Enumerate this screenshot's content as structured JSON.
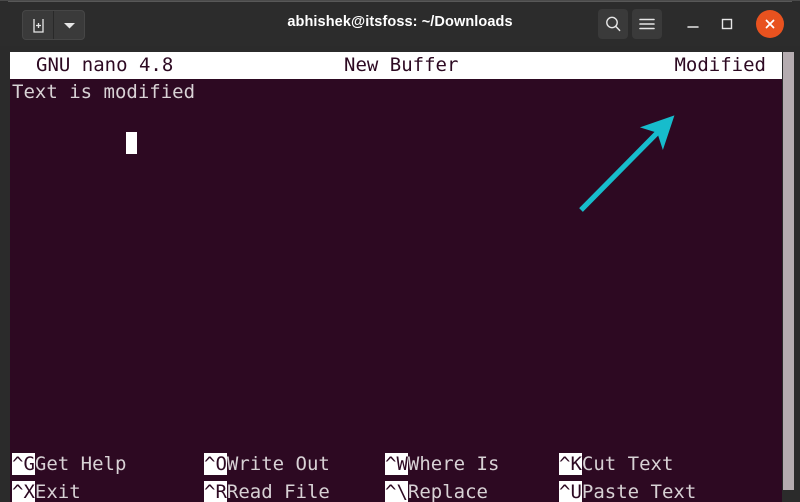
{
  "window": {
    "title": "abhishek@itsfoss: ~/Downloads",
    "titlebar_buttons": {
      "new_tab": "new-tab-icon",
      "dropdown": "chevron-down-icon",
      "search": "search-icon",
      "menu": "hamburger-menu-icon",
      "minimize": "minimize-icon",
      "maximize": "maximize-icon",
      "close": "close-icon"
    }
  },
  "colors": {
    "terminal_background": "#2d0922",
    "terminal_foreground": "#d8d2d5",
    "titlebar_background": "#2c2c2c",
    "close_button": "#e8521f",
    "annotation_arrow": "#17bccc",
    "scrollbar": "#b5acb0",
    "inverted_background": "#ffffff"
  },
  "nano": {
    "titlebar": {
      "version": "GNU nano 4.8",
      "buffer": "New Buffer",
      "state": "Modified"
    },
    "buffer_lines": [
      "Text is modified"
    ],
    "cursor": {
      "line": 2,
      "column": 1
    },
    "shortcuts": [
      {
        "key": "^G",
        "label": "Get Help",
        "row": 1,
        "col": 1
      },
      {
        "key": "^O",
        "label": "Write Out",
        "row": 1,
        "col": 2
      },
      {
        "key": "^W",
        "label": "Where Is",
        "row": 1,
        "col": 3
      },
      {
        "key": "^K",
        "label": "Cut Text",
        "row": 1,
        "col": 4
      },
      {
        "key": "^X",
        "label": "Exit",
        "row": 2,
        "col": 1
      },
      {
        "key": "^R",
        "label": "Read File",
        "row": 2,
        "col": 2
      },
      {
        "key": "^\\",
        "label": "Replace",
        "row": 2,
        "col": 3
      },
      {
        "key": "^U",
        "label": "Paste Text",
        "row": 2,
        "col": 4
      }
    ]
  },
  "annotation": {
    "type": "arrow",
    "color": "#17bccc",
    "points_to": "Modified"
  }
}
